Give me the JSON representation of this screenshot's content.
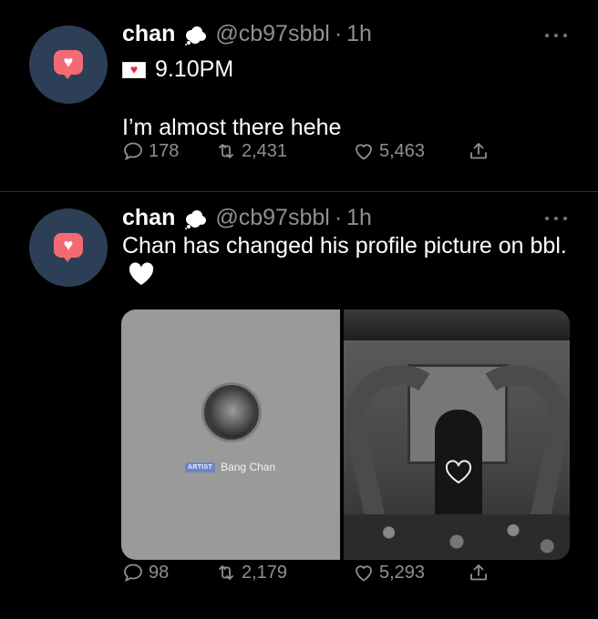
{
  "tweets": [
    {
      "author": "chan",
      "handle": "@cb97sbbl",
      "time": "1h",
      "subline": "9.10PM",
      "text": "I’m almost there hehe",
      "reply_count": "178",
      "retweet_count": "2,431",
      "like_count": "5,463"
    },
    {
      "author": "chan",
      "handle": "@cb97sbbl",
      "time": "1h",
      "text": "Chan has changed his profile picture on bbl.",
      "media": {
        "badge": "ARTIST",
        "artist_name": "Bang Chan"
      },
      "reply_count": "98",
      "retweet_count": "2,179",
      "like_count": "5,293"
    }
  ],
  "colors": {
    "background": "#000000",
    "secondary_text": "#8b9197",
    "avatar_bg": "#2d3e57",
    "avatar_bubble": "#f36a73",
    "badge": "#6b86c8"
  },
  "icons": [
    "more-icon",
    "cloud-icon",
    "envelope-heart-icon",
    "reply-icon",
    "retweet-icon",
    "like-icon",
    "share-icon",
    "white-heart-icon"
  ]
}
